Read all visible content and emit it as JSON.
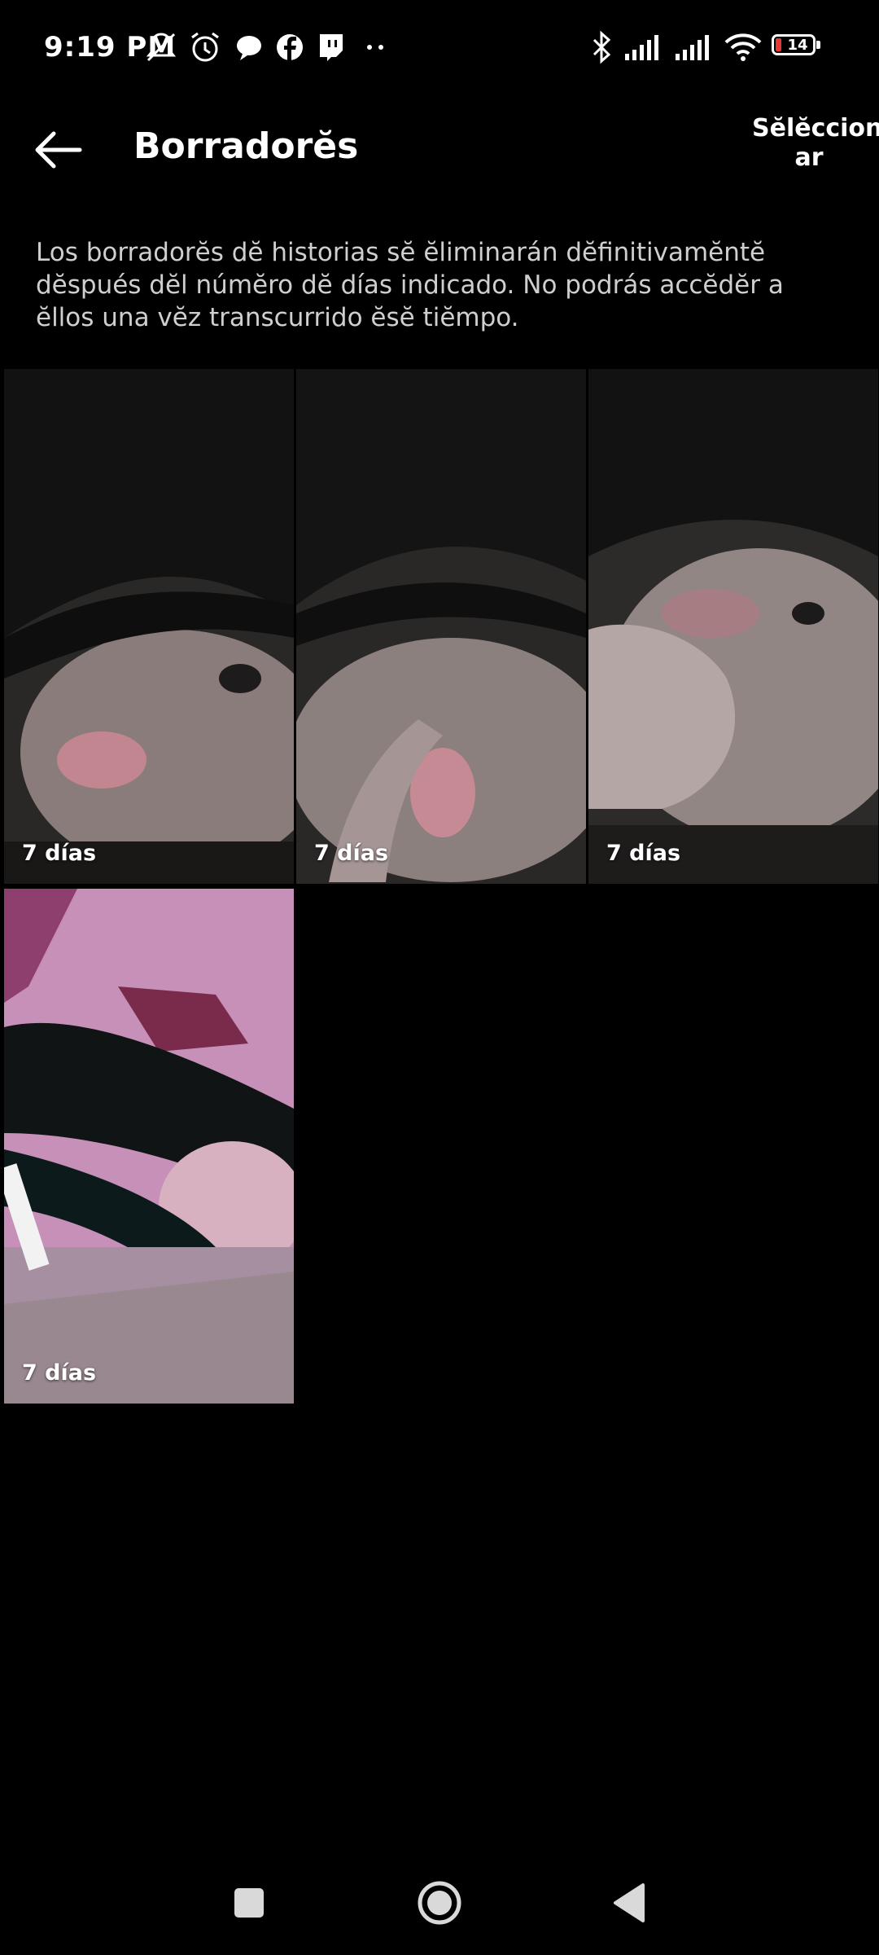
{
  "status_bar": {
    "time": "9:19 PM",
    "battery": "14",
    "icons": [
      "muted-bell-icon",
      "alarm-icon",
      "chat-bubble-icon",
      "facebook-icon",
      "twitch-icon",
      "more-dots-icon",
      "bluetooth-icon",
      "signal-icon",
      "signal-icon",
      "wifi-icon",
      "battery-icon"
    ]
  },
  "header": {
    "title": "Borradorĕs",
    "select_label_line1": "Sĕlĕccion",
    "select_label_line2": "ar"
  },
  "notice": "Los borradorĕs dĕ historias sĕ ĕliminarán dĕfinitivamĕntĕ dĕspués dĕl númĕro dĕ días indicado. No podrás accĕdĕr a ĕllos una vĕz transcurrido ĕsĕ tiĕmpo.",
  "drafts": [
    {
      "expires": "7 días"
    },
    {
      "expires": "7 días"
    },
    {
      "expires": "7 días"
    },
    {
      "expires": "7 días"
    }
  ],
  "nav": {
    "icons": [
      "recents-square-icon",
      "home-circle-icon",
      "back-triangle-icon"
    ]
  }
}
